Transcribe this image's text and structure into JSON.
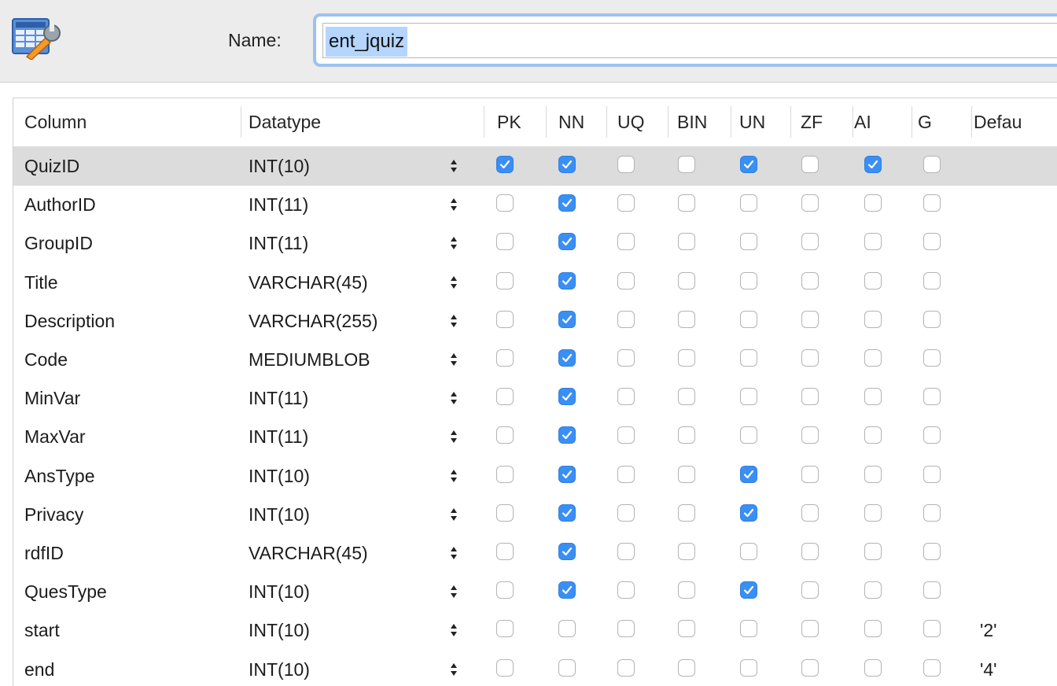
{
  "header": {
    "icon": "table-wrench-icon",
    "name_label": "Name:",
    "name_value": "ent_jquiz"
  },
  "columns_header": [
    "Column",
    "Datatype",
    "PK",
    "NN",
    "UQ",
    "BIN",
    "UN",
    "ZF",
    "AI",
    "G",
    "Defau"
  ],
  "rows": [
    {
      "name": "QuizID",
      "type": "INT(10)",
      "pk": true,
      "nn": true,
      "uq": false,
      "bin": false,
      "un": true,
      "zf": false,
      "ai": true,
      "g": false,
      "default": "",
      "selected": true
    },
    {
      "name": "AuthorID",
      "type": "INT(11)",
      "pk": false,
      "nn": true,
      "uq": false,
      "bin": false,
      "un": false,
      "zf": false,
      "ai": false,
      "g": false,
      "default": ""
    },
    {
      "name": "GroupID",
      "type": "INT(11)",
      "pk": false,
      "nn": true,
      "uq": false,
      "bin": false,
      "un": false,
      "zf": false,
      "ai": false,
      "g": false,
      "default": ""
    },
    {
      "name": "Title",
      "type": "VARCHAR(45)",
      "pk": false,
      "nn": true,
      "uq": false,
      "bin": false,
      "un": false,
      "zf": false,
      "ai": false,
      "g": false,
      "default": ""
    },
    {
      "name": "Description",
      "type": "VARCHAR(255)",
      "pk": false,
      "nn": true,
      "uq": false,
      "bin": false,
      "un": false,
      "zf": false,
      "ai": false,
      "g": false,
      "default": ""
    },
    {
      "name": "Code",
      "type": "MEDIUMBLOB",
      "pk": false,
      "nn": true,
      "uq": false,
      "bin": false,
      "un": false,
      "zf": false,
      "ai": false,
      "g": false,
      "default": ""
    },
    {
      "name": "MinVar",
      "type": "INT(11)",
      "pk": false,
      "nn": true,
      "uq": false,
      "bin": false,
      "un": false,
      "zf": false,
      "ai": false,
      "g": false,
      "default": ""
    },
    {
      "name": "MaxVar",
      "type": "INT(11)",
      "pk": false,
      "nn": true,
      "uq": false,
      "bin": false,
      "un": false,
      "zf": false,
      "ai": false,
      "g": false,
      "default": ""
    },
    {
      "name": "AnsType",
      "type": "INT(10)",
      "pk": false,
      "nn": true,
      "uq": false,
      "bin": false,
      "un": true,
      "zf": false,
      "ai": false,
      "g": false,
      "default": ""
    },
    {
      "name": "Privacy",
      "type": "INT(10)",
      "pk": false,
      "nn": true,
      "uq": false,
      "bin": false,
      "un": true,
      "zf": false,
      "ai": false,
      "g": false,
      "default": ""
    },
    {
      "name": "rdfID",
      "type": "VARCHAR(45)",
      "pk": false,
      "nn": true,
      "uq": false,
      "bin": false,
      "un": false,
      "zf": false,
      "ai": false,
      "g": false,
      "default": ""
    },
    {
      "name": "QuesType",
      "type": "INT(10)",
      "pk": false,
      "nn": true,
      "uq": false,
      "bin": false,
      "un": true,
      "zf": false,
      "ai": false,
      "g": false,
      "default": ""
    },
    {
      "name": "start",
      "type": "INT(10)",
      "pk": false,
      "nn": false,
      "uq": false,
      "bin": false,
      "un": false,
      "zf": false,
      "ai": false,
      "g": false,
      "default": "'2'"
    },
    {
      "name": "end",
      "type": "INT(10)",
      "pk": false,
      "nn": false,
      "uq": false,
      "bin": false,
      "un": false,
      "zf": false,
      "ai": false,
      "g": false,
      "default": "'4'"
    }
  ],
  "colors": {
    "checkbox_on": "#3a8ff4",
    "selection": "#b5d5fd",
    "row_selected": "#dcdcdc",
    "focus_ring": "#9cc3ef"
  }
}
